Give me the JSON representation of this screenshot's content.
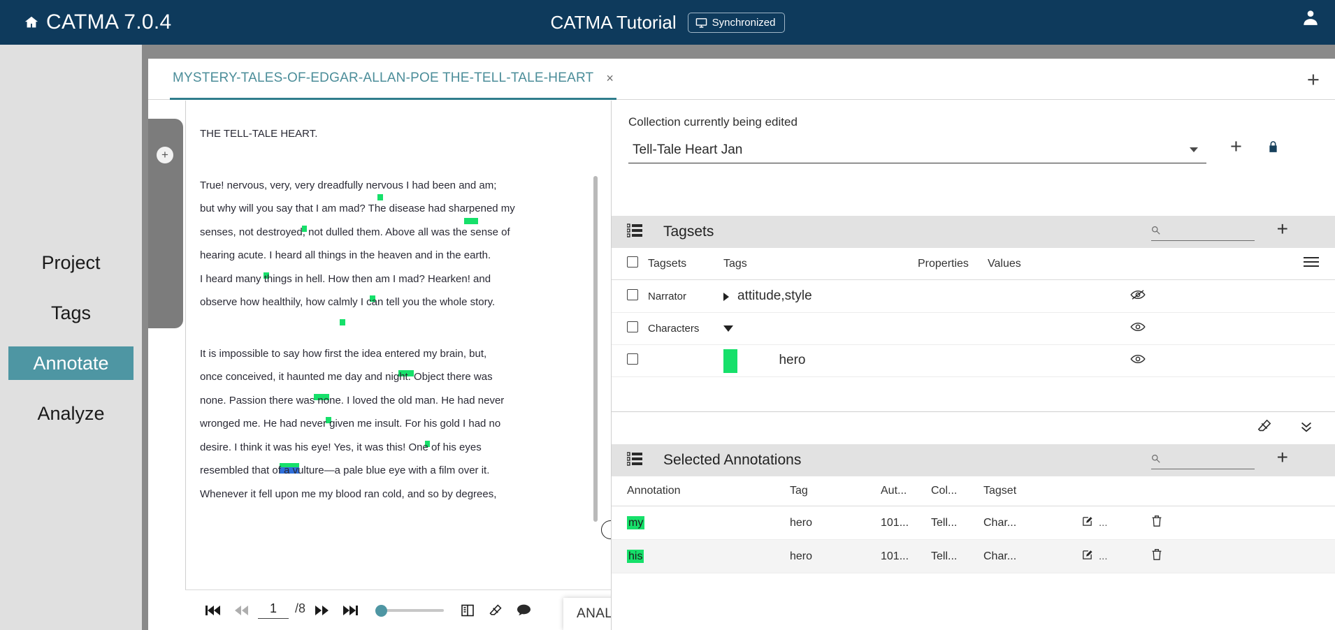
{
  "topbar": {
    "brand": "CATMA 7.0.4",
    "home_icon": "home-icon",
    "app_title": "CATMA Tutorial",
    "sync_label": "Synchronized",
    "sync_icon": "monitor-icon",
    "user_icon": "user-account-icon"
  },
  "sidebar": {
    "items": [
      {
        "label": "Project",
        "active": false
      },
      {
        "label": "Tags",
        "active": false
      },
      {
        "label": "Annotate",
        "active": true
      },
      {
        "label": "Analyze",
        "active": false
      }
    ],
    "active_color": "#4e96a3"
  },
  "tabs": {
    "open": {
      "label": "MYSTERY-TALES-OF-EDGAR-ALLAN-POE THE-TELL-TALE-HEART",
      "close": "×"
    },
    "add": "+"
  },
  "document": {
    "title": "THE TELL-TALE HEART.",
    "paragraphs": [
      [
        "True! nervous, very, very dreadfully nervous I had been and am;",
        "but why will you say that I am mad? The disease had sharpened my",
        "senses, not destroyed, not dulled them. Above all was the sense of",
        " hearing acute. I heard all things in the heaven and in the earth.",
        " I heard many things in hell. How then am I mad? Hearken! and",
        "observe how healthily, how calmly I can tell you the whole story."
      ],
      [
        "It is impossible to say how first the idea entered my brain, but,",
        "once conceived, it haunted me day and night. Object there was",
        "none. Passion there was none. I loved the old man. He had never",
        "wronged me. He had never given me insult. For his gold I had no",
        "desire. I think it was his eye! Yes, it was this! One of his eyes",
        "resembled that of a vulture—a pale blue eye with a film over it.",
        "Whenever it fell upon me my blood ran cold, and so by degrees,"
      ]
    ],
    "annotation_color": "#16e06a",
    "annotation_color_alt": "#2f6fdb",
    "annotation_pill": {
      "plus": "+",
      "comment_icon": "comment-bubble-icon"
    },
    "handle_plus": "+"
  },
  "doc_toolbar": {
    "first_icon": "skip-to-first-icon",
    "prev_icon": "previous-page-icon",
    "page_value": "1",
    "page_total": "/8",
    "next_icon": "next-page-icon",
    "last_icon": "skip-to-last-icon",
    "zoom_slider_value": "0",
    "layout_icon": "page-layout-icon",
    "eraser_icon": "eraser-icon",
    "comment_icon": "comment-bubble-icon",
    "analyze_label": "ANALYZE"
  },
  "collection": {
    "label": "Collection currently being edited",
    "value": "Tell-Tale Heart Jan",
    "add": "+",
    "lock_icon": "lock-icon",
    "dropdown_icon": "chevron-down-icon"
  },
  "tagsets_panel": {
    "title": "Tagsets",
    "list_icon": "list-icon",
    "search_icon": "search-icon",
    "search_value": "",
    "add": "+",
    "menu_icon": "kebab-menu-icon",
    "grid_menu_icon": "grid-options-icon",
    "columns": [
      "Tagsets",
      "Tags",
      "Properties",
      "Values"
    ],
    "rows": [
      {
        "tagset": "Narrator",
        "tag": "attitude,style",
        "properties": "",
        "values": "",
        "expander": "collapsed",
        "color": "",
        "visible_icon": "eye-off-icon",
        "indent": 0
      },
      {
        "tagset": "Characters",
        "tag": "",
        "properties": "",
        "values": "",
        "expander": "expanded",
        "color": "",
        "visible_icon": "eye-icon",
        "indent": 0
      },
      {
        "tagset": "",
        "tag": "hero",
        "properties": "",
        "values": "",
        "expander": "none",
        "color": "#16e06a",
        "visible_icon": "eye-icon",
        "indent": 1
      }
    ],
    "footer": {
      "eraser_icon": "eraser-icon",
      "collapse_icon": "chevrons-down-icon"
    }
  },
  "annotations_panel": {
    "title": "Selected Annotations",
    "list_icon": "list-icon",
    "search_icon": "search-icon",
    "search_value": "",
    "add": "+",
    "menu_icon": "kebab-menu-icon",
    "columns": [
      "Annotation",
      "Tag",
      "Aut...",
      "Col...",
      "Tagset",
      "",
      ""
    ],
    "rows": [
      {
        "annotation": "my",
        "tag": "hero",
        "author": "101...",
        "collection": "Tell...",
        "tagset": "Char...",
        "edit_icon": "edit-icon",
        "more": "...",
        "delete_icon": "trash-icon"
      },
      {
        "annotation": "his",
        "tag": "hero",
        "author": "101...",
        "collection": "Tell...",
        "tagset": "Char...",
        "edit_icon": "edit-icon",
        "more": "...",
        "delete_icon": "trash-icon"
      }
    ]
  }
}
